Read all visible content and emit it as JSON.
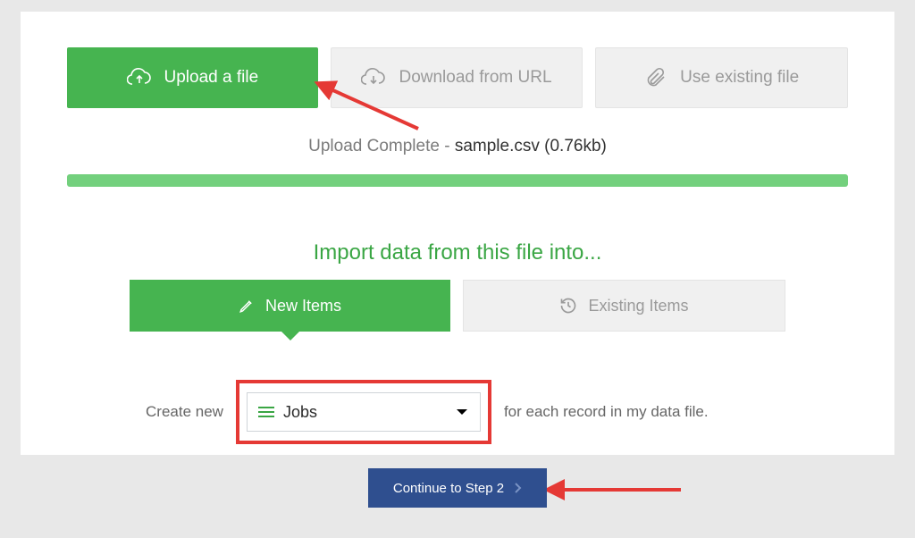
{
  "top_tabs": {
    "upload": {
      "label": "Upload a file"
    },
    "download": {
      "label": "Download from URL"
    },
    "existing": {
      "label": "Use existing file"
    }
  },
  "status": {
    "prefix": "Upload Complete - ",
    "filename": "sample.csv",
    "size_text": " (0.76kb)"
  },
  "section_heading": "Import data from this file into...",
  "mid_tabs": {
    "new": {
      "label": "New Items"
    },
    "existing": {
      "label": "Existing Items"
    }
  },
  "sentence": {
    "before": "Create new",
    "after": "for each record in my data file."
  },
  "select": {
    "value": "Jobs"
  },
  "continue_label": "Continue to Step 2"
}
